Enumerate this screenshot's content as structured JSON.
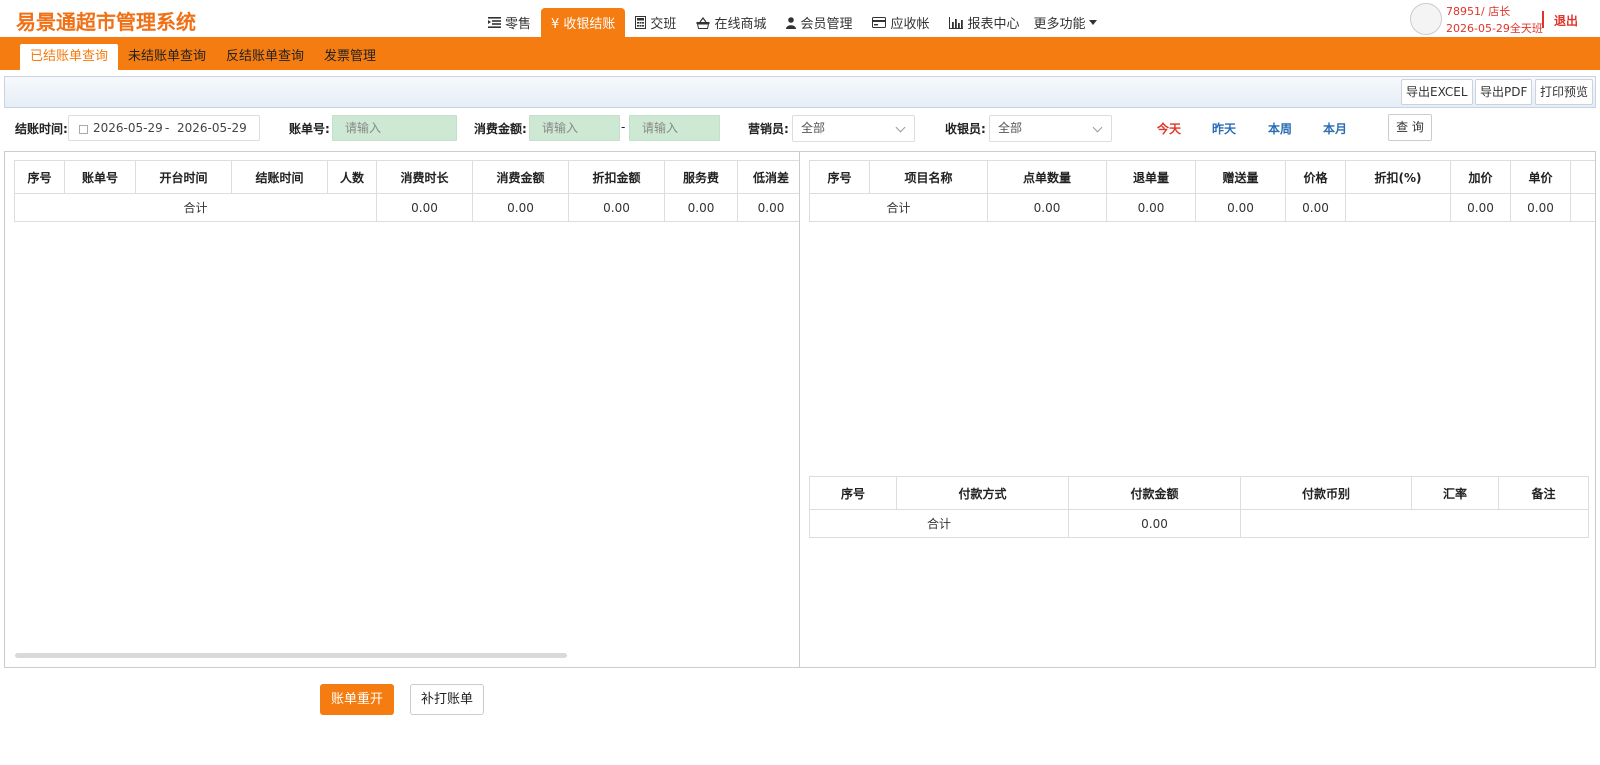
{
  "app": {
    "title": "易景通超市管理系统"
  },
  "main_nav": [
    {
      "label": "零售",
      "icon": "list-indent-icon",
      "active": false
    },
    {
      "label": "¥ 收银结账",
      "icon": "",
      "active": true
    },
    {
      "label": "交班",
      "icon": "calculator-icon",
      "active": false
    },
    {
      "label": "在线商城",
      "icon": "basket-icon",
      "active": false
    },
    {
      "label": "会员管理",
      "icon": "user-icon",
      "active": false
    },
    {
      "label": "应收帐",
      "icon": "credit-card-icon",
      "active": false
    },
    {
      "label": "报表中心",
      "icon": "bar-chart-icon",
      "active": false
    },
    {
      "label": "更多功能",
      "icon": "caret-down-icon",
      "active": false
    }
  ],
  "user": {
    "line1": "78951/ 店长",
    "line2": "2026-05-29全天班",
    "logout": "退出"
  },
  "sub_nav": [
    {
      "label": "已结账单查询",
      "active": true
    },
    {
      "label": "未结账单查询",
      "active": false
    },
    {
      "label": "反结账单查询",
      "active": false
    },
    {
      "label": "发票管理",
      "active": false
    }
  ],
  "toolbar": {
    "export_excel": "导出EXCEL",
    "export_pdf": "导出PDF",
    "print_preview": "打印预览"
  },
  "filters": {
    "settle_time_label": "结账时间:",
    "date_from": "2026-05-29",
    "date_sep": "-",
    "date_to": "2026-05-29",
    "bill_no_label": "账单号:",
    "bill_no_placeholder": "请输入",
    "amount_label": "消费金额:",
    "amount_from_placeholder": "请输入",
    "amount_sep": "-",
    "amount_to_placeholder": "请输入",
    "salesperson_label": "营销员:",
    "salesperson_value": "全部",
    "cashier_label": "收银员:",
    "cashier_value": "全部",
    "today": "今天",
    "yesterday": "昨天",
    "this_week": "本周",
    "this_month": "本月",
    "query": "查 询"
  },
  "bills_table": {
    "headers": [
      "序号",
      "账单号",
      "开台时间",
      "结账时间",
      "人数",
      "消费时长",
      "消费金额",
      "折扣金额",
      "服务费",
      "低消差"
    ],
    "total_label": "合计",
    "totals": [
      "0.00",
      "0.00",
      "0.00",
      "0.00",
      "0.00"
    ]
  },
  "items_table": {
    "headers": [
      "序号",
      "项目名称",
      "点单数量",
      "退单量",
      "赠送量",
      "价格",
      "折扣(%)",
      "加价",
      "单价"
    ],
    "total_label": "合计",
    "totals": [
      "0.00",
      "0.00",
      "0.00",
      "0.00",
      "",
      "0.00",
      "0.00"
    ]
  },
  "payments_table": {
    "headers": [
      "序号",
      "付款方式",
      "付款金额",
      "付款币别",
      "汇率",
      "备注"
    ],
    "total_label": "合计",
    "total_amount": "0.00"
  },
  "actions": {
    "reopen": "账单重开",
    "reprint": "补打账单"
  },
  "colors": {
    "brand": "#f57c10",
    "alert": "#e0342a",
    "link": "#2a6db5",
    "input_bg": "#cde8d3"
  }
}
